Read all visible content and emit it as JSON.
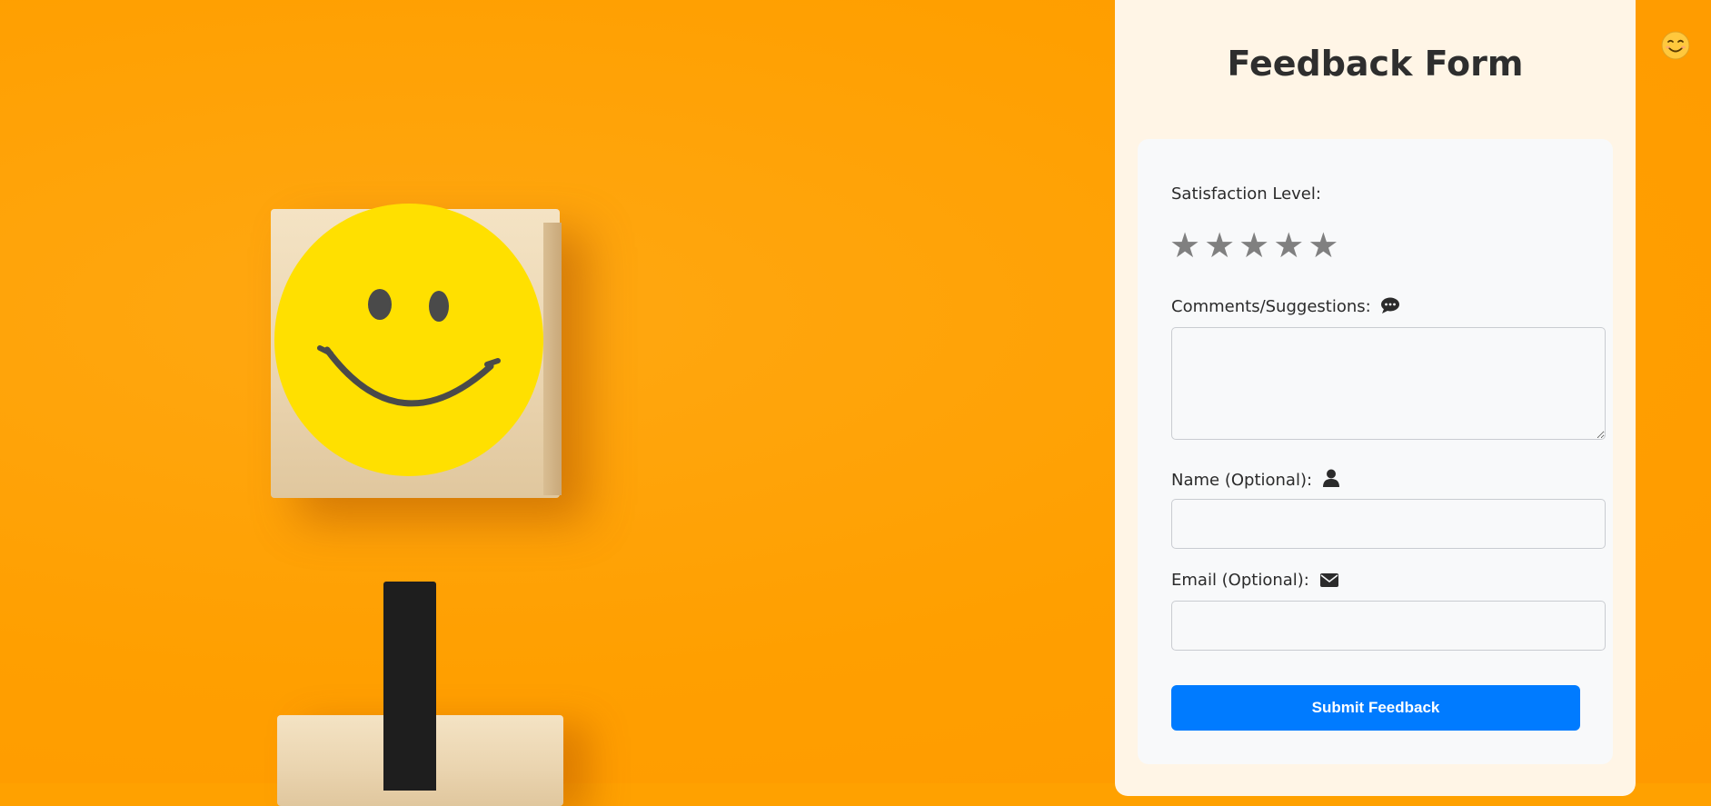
{
  "form": {
    "title": "Feedback Form",
    "satisfaction_label": "Satisfaction Level:",
    "rating": 0,
    "stars": [
      "★",
      "★",
      "★",
      "★",
      "★"
    ],
    "comments_label": "Comments/Suggestions:",
    "comments_value": "",
    "name_label": "Name (Optional):",
    "name_value": "",
    "email_label": "Email (Optional):",
    "email_value": "",
    "submit_label": "Submit Feedback"
  },
  "icons": {
    "comments": "speech-bubble-icon",
    "name": "user-icon",
    "email": "envelope-icon",
    "corner": "smiling-face-emoji"
  },
  "colors": {
    "background": "#FFA100",
    "panel": "#FFF5E6",
    "card": "#F8F9FA",
    "button": "#007BFF",
    "star": "#808080"
  }
}
